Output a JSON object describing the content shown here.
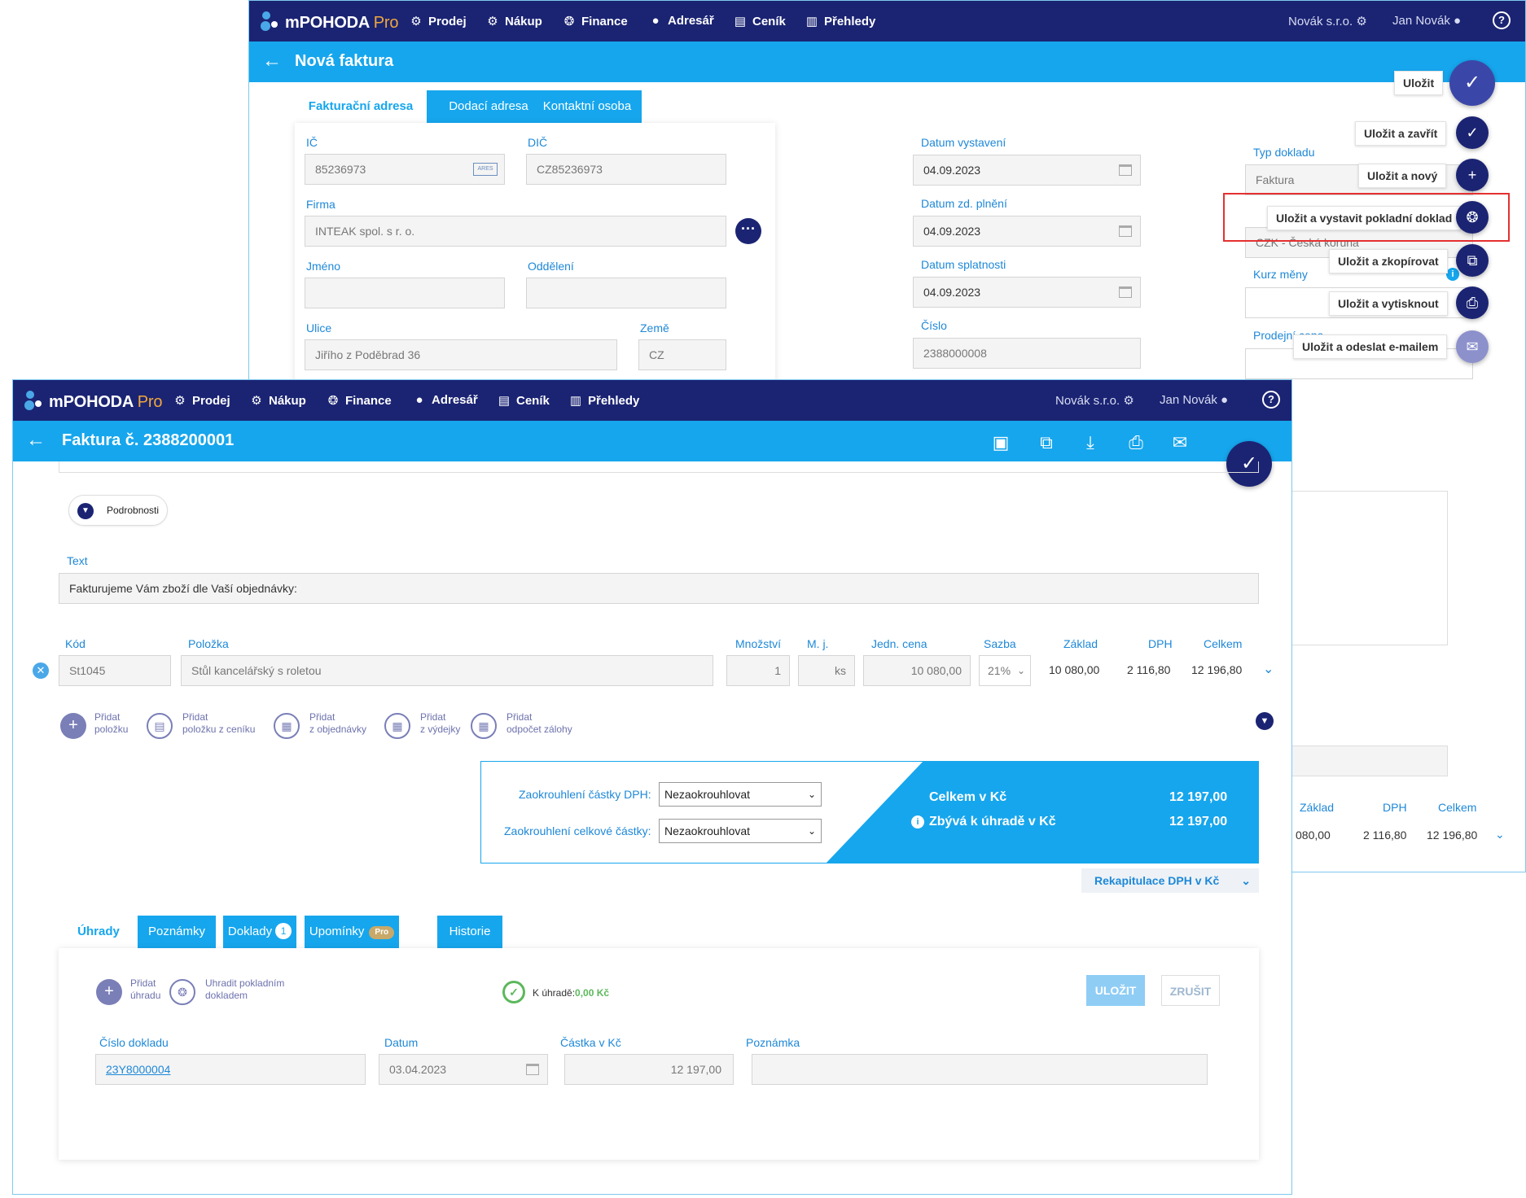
{
  "app": {
    "logo_main": "mPOHODA",
    "logo_pro": "Pro",
    "nav": [
      "Prodej",
      "Nákup",
      "Finance",
      "Adresář",
      "Ceník",
      "Přehledy"
    ],
    "company": "Novák s.r.o.",
    "user": "Jan Novák",
    "help": "?"
  },
  "back_window": {
    "title": "Nová faktura",
    "tabs": [
      "Fakturační adresa",
      "Dodací adresa",
      "Kontaktní osoba"
    ],
    "fields": {
      "ic_label": "IČ",
      "ic_value": "85236973",
      "ares": "ARES",
      "dic_label": "DIČ",
      "dic_value": "CZ85236973",
      "firma_label": "Firma",
      "firma_value": "INTEAK spol. s r. o.",
      "jmeno_label": "Jméno",
      "oddeleni_label": "Oddělení",
      "ulice_label": "Ulice",
      "ulice_value": "Jiřího z Poděbrad 36",
      "zeme_label": "Země",
      "zeme_value": "CZ",
      "datum_vystaveni_label": "Datum vystavení",
      "datum_vystaveni_value": "04.09.2023",
      "datum_zd_label": "Datum zd. plnění",
      "datum_zd_value": "04.09.2023",
      "datum_splatnosti_label": "Datum splatnosti",
      "datum_splatnosti_value": "04.09.2023",
      "cislo_label": "Číslo",
      "cislo_value": "2388000008",
      "typ_label": "Typ dokladu",
      "typ_value": "Faktura",
      "mena_value": "CZK - Česká koruna",
      "kurz_label": "Kurz měny",
      "prodejni_label": "Prodejní cena"
    },
    "fab_actions": [
      "Uložit",
      "Uložit a zavřít",
      "Uložit a nový",
      "Uložit a vystavit pokladní doklad",
      "Uložit a zkopírovat",
      "Uložit a vytisknout",
      "Uložit a odeslat e-mailem"
    ],
    "right_table": {
      "headers": [
        "Základ",
        "DPH",
        "Celkem"
      ],
      "values": [
        "080,00",
        "2 116,80",
        "12 196,80"
      ]
    }
  },
  "front_window": {
    "title": "Faktura č. 2388200001",
    "details_button": "Podrobnosti",
    "text_label": "Text",
    "text_value": "Fakturujeme Vám zboží dle Vaší objednávky:",
    "items_headers": [
      "Kód",
      "Položka",
      "Množství",
      "M. j.",
      "Jedn. cena",
      "Sazba",
      "Základ",
      "DPH",
      "Celkem"
    ],
    "item": {
      "kod": "St1045",
      "polozka": "Stůl kancelářský s roletou",
      "mnozstvi": "1",
      "mj": "ks",
      "jedn_cena": "10 080,00",
      "sazba": "21%",
      "zaklad": "10 080,00",
      "dph": "2 116,80",
      "celkem": "12 196,80"
    },
    "add_actions": [
      {
        "l1": "Přidat",
        "l2": "položku"
      },
      {
        "l1": "Přidat",
        "l2": "položku z ceníku"
      },
      {
        "l1": "Přidat",
        "l2": "z objednávky"
      },
      {
        "l1": "Přidat",
        "l2": "z výdejky"
      },
      {
        "l1": "Přidat",
        "l2": "odpočet zálohy"
      }
    ],
    "rounding": {
      "dph_label": "Zaokrouhlení částky DPH:",
      "dph_value": "Nezaokrouhlovat",
      "total_label": "Zaokrouhlení celkové částky:",
      "total_value": "Nezaokrouhlovat"
    },
    "summary": {
      "celkem_label": "Celkem v Kč",
      "celkem_value": "12 197,00",
      "zbyva_label": "Zbývá k úhradě v Kč",
      "zbyva_value": "12 197,00"
    },
    "rekap_button": "Rekapitulace DPH v Kč",
    "bottom_tabs": [
      "Úhrady",
      "Poznámky",
      "Doklady",
      "Upomínky",
      "Historie"
    ],
    "doklady_count": "1",
    "pro_badge": "Pro",
    "payments": {
      "add_l1": "Přidat",
      "add_l2": "úhradu",
      "cash_l1": "Uhradit pokladním",
      "cash_l2": "dokladem",
      "k_uhrade_label": "K úhradě:",
      "k_uhrade_value": "0,00 Kč",
      "save": "ULOŽIT",
      "cancel": "ZRUŠIT",
      "headers": [
        "Číslo dokladu",
        "Datum",
        "Částka v Kč",
        "Poznámka"
      ],
      "cislo": "23Y8000004",
      "datum": "03.04.2023",
      "castka": "12 197,00",
      "poznamka": ""
    }
  },
  "colors": {
    "navy": "#1b2473",
    "blue": "#16a6ed",
    "label_blue": "#1e88d8",
    "pro_orange": "#f0a73d",
    "highlight_red": "#e53030"
  }
}
